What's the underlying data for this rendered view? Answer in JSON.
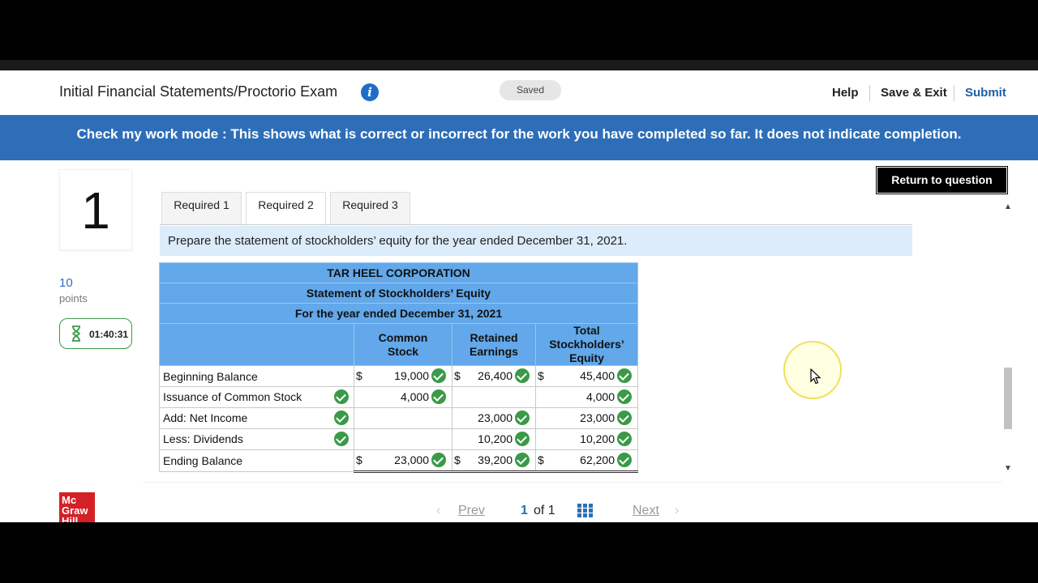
{
  "header": {
    "title": "Initial Financial Statements/Proctorio Exam",
    "saved": "Saved",
    "help": "Help",
    "save_exit": "Save & Exit",
    "submit": "Submit",
    "info_icon": "info-icon"
  },
  "banner": {
    "text": "Check my work mode : This shows what is correct or incorrect for the work you have completed so far. It does not indicate completion."
  },
  "question": {
    "number": "1",
    "points_value": "10",
    "points_label": "points",
    "timer": "01:40:31",
    "return_button": "Return to question"
  },
  "tabs": [
    {
      "label": "Required 1"
    },
    {
      "label": "Required 2"
    },
    {
      "label": "Required 3"
    }
  ],
  "instructions": "Prepare the statement of stockholders’ equity for the year ended December 31, 2021.",
  "statement": {
    "company": "TAR HEEL CORPORATION",
    "name": "Statement of Stockholders’ Equity",
    "period": "For the year ended December 31, 2021",
    "columns": {
      "common_stock": [
        "Common",
        "Stock"
      ],
      "retained_earnings": [
        "Retained",
        "Earnings"
      ],
      "total": [
        "Total",
        "Stockholders’",
        "Equity"
      ]
    },
    "rows": {
      "beginning": {
        "label": "Beginning Balance",
        "dollar": "$",
        "common": "19,000",
        "retained": "26,400",
        "total": "45,400"
      },
      "issuance": {
        "label": "Issuance of Common Stock",
        "common": "4,000",
        "total": "4,000"
      },
      "net_income": {
        "label": "Add: Net Income",
        "retained": "23,000",
        "total": "23,000"
      },
      "dividends": {
        "label": "Less: Dividends",
        "retained": "10,200",
        "total": "10,200"
      },
      "ending": {
        "label": "Ending Balance",
        "dollar": "$",
        "common": "23,000",
        "retained": "39,200",
        "total": "62,200"
      }
    }
  },
  "footer": {
    "logo": [
      "Mc",
      "Graw",
      "Hill"
    ],
    "prev": "Prev",
    "current": "1",
    "of": "of",
    "total": "1",
    "next": "Next"
  }
}
